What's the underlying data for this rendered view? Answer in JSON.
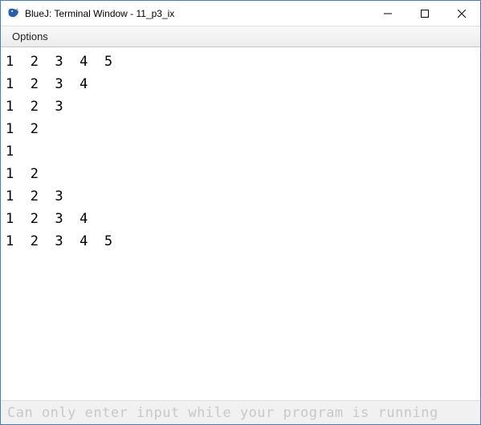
{
  "window": {
    "title": "BlueJ: Terminal Window - 11_p3_ix"
  },
  "menubar": {
    "options_label": "Options"
  },
  "terminal": {
    "lines": [
      "1  2  3  4  5",
      "1  2  3  4",
      "1  2  3",
      "1  2",
      "1",
      "1  2",
      "1  2  3",
      "1  2  3  4",
      "1  2  3  4  5"
    ]
  },
  "input": {
    "placeholder": "Can only enter input while your program is running",
    "value": ""
  }
}
